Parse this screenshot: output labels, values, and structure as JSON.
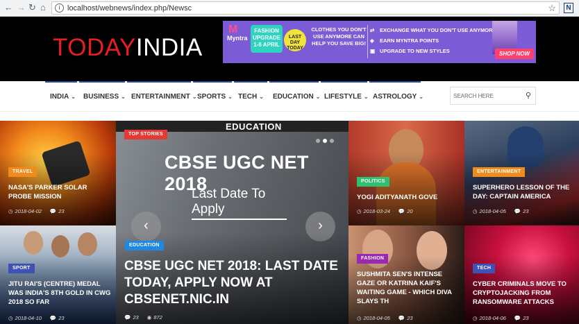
{
  "browser": {
    "back": "←",
    "forward": "→",
    "reload": "↻",
    "home": "⌂",
    "url": "localhost/webnews/index.php/Newsc",
    "bookmark_icon": "star-icon",
    "extension_label": "N"
  },
  "header": {
    "logo_part1": "TODAY",
    "logo_part2": "INDIA",
    "ad": {
      "brand": "Myntra",
      "badge": "FASHION UPGRADE",
      "dates": "1-6 APRIL",
      "last_day": "LAST DAY TODAY",
      "copy": "CLOTHES YOU DON'T USE ANYMORE CAN HELP YOU SAVE BIG!",
      "line1": "EXCHANGE WHAT YOU DON'T USE ANYMORE",
      "line2": "EARN MYNTRA POINTS",
      "line3": "UPGRADE TO NEW STYLES",
      "cta": "SHOP NOW"
    }
  },
  "nav": {
    "items": [
      "INDIA",
      "BUSINESS",
      "ENTERTAINMENT",
      "SPORTS",
      "TECH",
      "EDUCATION",
      "LIFESTYLE",
      "ASTROLOGY"
    ],
    "search_placeholder": "SEARCH HERE"
  },
  "colors": {
    "logo_accent": "#e41e26",
    "nav_accent": "#2b4ea6",
    "travel": "#f08b1c",
    "top_stories": "#e53935",
    "education": "#1f88e5",
    "politics": "#2fbf71",
    "entertainment": "#f08b1c",
    "sport": "#3f51b5",
    "fashion": "#9c27b0",
    "tech": "#3f51b5"
  },
  "cards": {
    "travel": {
      "tag": "TRAVEL",
      "title": "NASA'S PARKER SOLAR PROBE MISSION",
      "date": "2018-04-02",
      "comments": "23"
    },
    "featured": {
      "tag_top": "TOP STORIES",
      "slide_header": "EDUCATION",
      "slide_title": "CBSE UGC NET 2018",
      "slide_sub": "Last Date To Apply",
      "tag": "EDUCATION",
      "title": "CBSE UGC NET 2018: LAST DATE TODAY, APPLY NOW AT CBSENET.NIC.IN",
      "comments": "23",
      "views": "872"
    },
    "politics": {
      "tag": "POLITICS",
      "title": "YOGI ADITYANATH GOVE",
      "date": "2018-03-24",
      "comments": "20"
    },
    "entertainment": {
      "tag": "ENTERTAINMENT",
      "title": "SUPERHERO LESSON OF THE DAY: CAPTAIN AMERICA",
      "date": "2018-04-05",
      "comments": "23"
    },
    "sport": {
      "tag": "SPORT",
      "title": "JITU RAI'S (CENTRE) MEDAL WAS INDIA'S 8TH GOLD IN CWG 2018 SO FAR",
      "date": "2018-04-10",
      "comments": "23"
    },
    "fashion": {
      "tag": "FASHION",
      "title": "SUSHMITA SEN'S INTENSE GAZE OR KATRINA KAIF'S WAITING GAME - WHICH DIVA SLAYS TH",
      "date": "2018-04-05",
      "comments": "23"
    },
    "tech": {
      "tag": "TECH",
      "title": "CYBER CRIMINALS MOVE TO CRYPTOJACKING FROM RANSOMWARE ATTACKS",
      "date": "2018-04-06",
      "comments": "23"
    }
  }
}
